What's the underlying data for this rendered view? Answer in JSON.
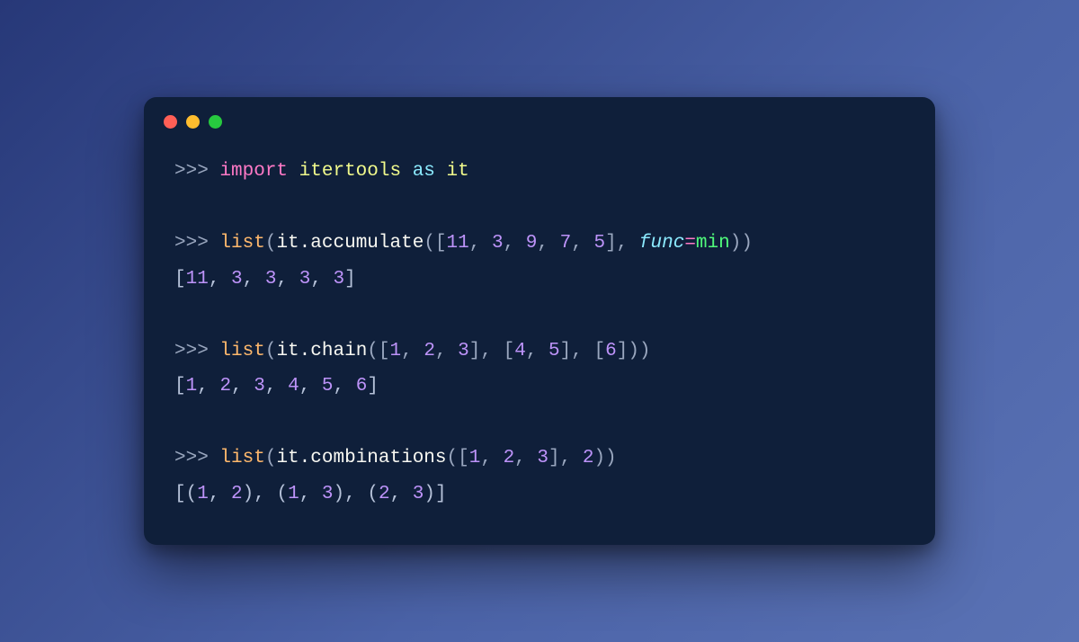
{
  "prompt": ">>>",
  "line1": {
    "import": "import",
    "module": "itertools",
    "as": "as",
    "alias": "it"
  },
  "line2": {
    "func": "list",
    "obj": "it",
    "dot": ".",
    "method": "accumulate",
    "nums": [
      "11",
      "3",
      "9",
      "7",
      "5"
    ],
    "kwarg": "func",
    "eq": "=",
    "builtin": "min"
  },
  "out2": {
    "open": "[",
    "vals": [
      "11",
      "3",
      "3",
      "3",
      "3"
    ],
    "close": "]"
  },
  "line3": {
    "func": "list",
    "obj": "it",
    "dot": ".",
    "method": "chain",
    "group1": [
      "1",
      "2",
      "3"
    ],
    "group2": [
      "4",
      "5"
    ],
    "group3": [
      "6"
    ]
  },
  "out3": {
    "open": "[",
    "vals": [
      "1",
      "2",
      "3",
      "4",
      "5",
      "6"
    ],
    "close": "]"
  },
  "line4": {
    "func": "list",
    "obj": "it",
    "dot": ".",
    "method": "combinations",
    "group": [
      "1",
      "2",
      "3"
    ],
    "k": "2"
  },
  "out4": {
    "open": "[",
    "pairs": [
      [
        "1",
        "2"
      ],
      [
        "1",
        "3"
      ],
      [
        "2",
        "3"
      ]
    ],
    "close": "]"
  }
}
